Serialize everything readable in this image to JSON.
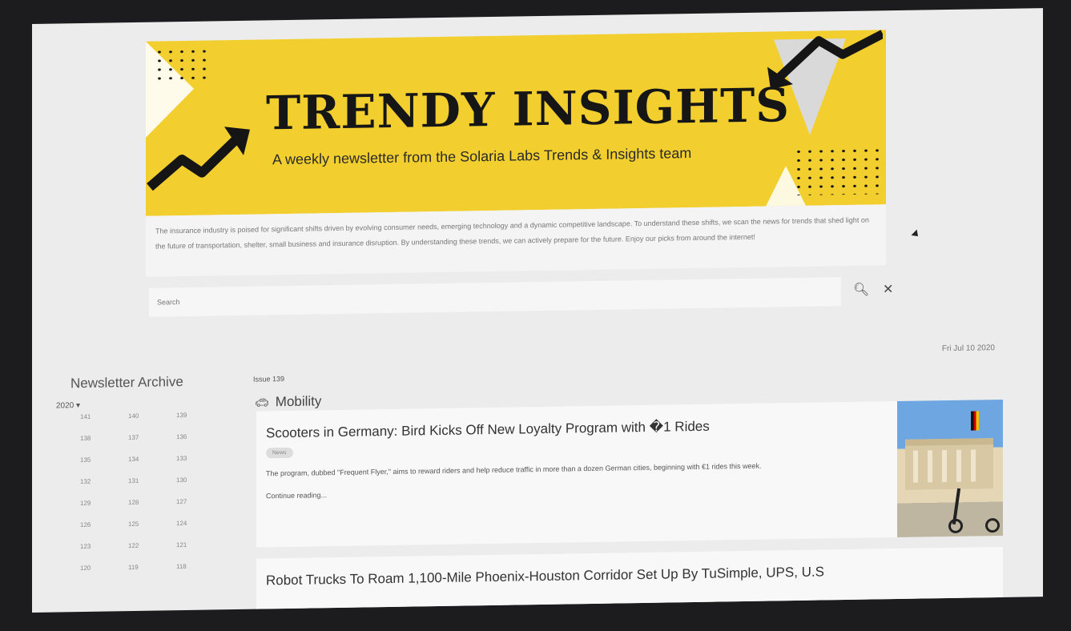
{
  "banner": {
    "title": "TRENDY INSIGHTS",
    "subtitle": "A weekly newsletter from the Solaria Labs Trends & Insights team"
  },
  "intro": {
    "text": "The insurance industry is poised for significant shifts driven by evolving consumer needs, emerging technology and a dynamic competitive landscape. To understand these shifts, we scan the news for trends that shed light on the future of transportation, shelter, small business and insurance disruption. By understanding these trends, we can actively prepare for the future. Enjoy our picks from around the internet!"
  },
  "search": {
    "placeholder": "Search"
  },
  "date": "Fri Jul 10 2020",
  "archive": {
    "title": "Newsletter Archive",
    "year": "2020",
    "issues": [
      "141",
      "140",
      "139",
      "138",
      "137",
      "136",
      "135",
      "134",
      "133",
      "132",
      "131",
      "130",
      "129",
      "128",
      "127",
      "126",
      "125",
      "124",
      "123",
      "122",
      "121",
      "120",
      "119",
      "118"
    ]
  },
  "main": {
    "issue_label": "Issue 139",
    "category": "Mobility",
    "articles": [
      {
        "title": "Scooters in Germany: Bird Kicks Off New Loyalty Program with �1 Rides",
        "tag": "News",
        "description": "The program, dubbed \"Frequent Flyer,\" aims to reward riders and help reduce traffic in more than a dozen German cities, beginning with €1 rides this week.",
        "more": "Continue reading..."
      },
      {
        "title": "Robot Trucks To Roam 1,100-Mile Phoenix-Houston Corridor Set Up By TuSimple, UPS, U.S"
      }
    ]
  }
}
